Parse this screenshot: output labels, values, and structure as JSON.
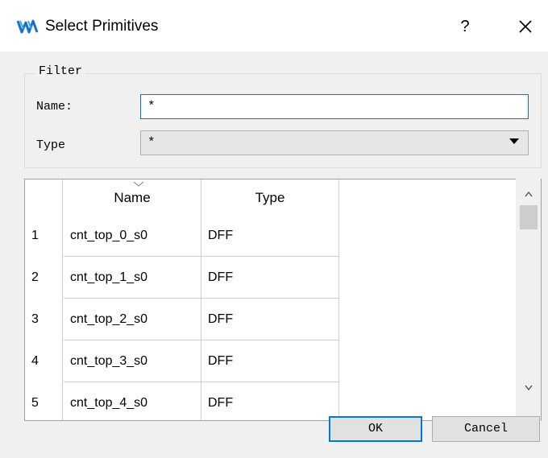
{
  "window": {
    "title": "Select Primitives",
    "help_label": "?",
    "logo_icon": "gowin-logo-icon",
    "close_icon": "close-icon"
  },
  "filter": {
    "legend": "Filter",
    "name_label": "Name:",
    "name_value": "*",
    "type_label": "Type",
    "type_value": "*"
  },
  "table": {
    "columns": [
      "Name",
      "Type"
    ],
    "rows": [
      {
        "num": "1",
        "name": "cnt_top_0_s0",
        "type": "DFF"
      },
      {
        "num": "2",
        "name": "cnt_top_1_s0",
        "type": "DFF"
      },
      {
        "num": "3",
        "name": "cnt_top_2_s0",
        "type": "DFF"
      },
      {
        "num": "4",
        "name": "cnt_top_3_s0",
        "type": "DFF"
      },
      {
        "num": "5",
        "name": "cnt_top_4_s0",
        "type": "DFF"
      }
    ]
  },
  "buttons": {
    "ok": "OK",
    "cancel": "Cancel"
  },
  "colors": {
    "accent": "#0078d7",
    "logo_blue": "#1a6fd1"
  }
}
